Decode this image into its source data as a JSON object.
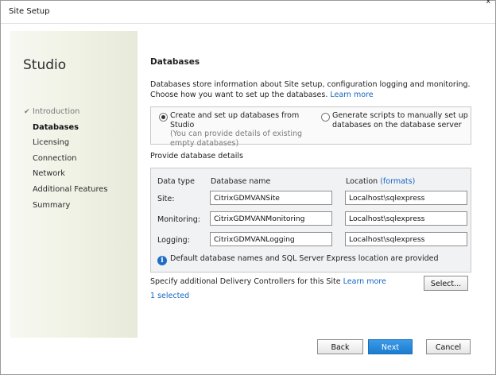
{
  "window": {
    "title": "Site Setup",
    "corner_mark": "x"
  },
  "sidebar": {
    "brand": "Studio",
    "steps": [
      {
        "label": "Introduction",
        "state": "done"
      },
      {
        "label": "Databases",
        "state": "active"
      },
      {
        "label": "Licensing",
        "state": "pending"
      },
      {
        "label": "Connection",
        "state": "pending"
      },
      {
        "label": "Network",
        "state": "pending"
      },
      {
        "label": "Additional Features",
        "state": "pending"
      },
      {
        "label": "Summary",
        "state": "pending"
      }
    ]
  },
  "main": {
    "heading": "Databases",
    "intro_line1": "Databases store information about Site setup, configuration logging and monitoring.",
    "intro_line2": "Choose how you want to set up the databases.",
    "learn_more": "Learn more",
    "options": {
      "create": {
        "label": "Create and set up databases from Studio",
        "sub": "(You can provide details of existing empty databases)",
        "selected": true
      },
      "generate": {
        "label": "Generate scripts to manually set up databases on the database server",
        "selected": false
      }
    },
    "details_label": "Provide database details",
    "table": {
      "col_type": "Data type",
      "col_name": "Database name",
      "col_location": "Location",
      "formats_link": "(formats)",
      "rows": [
        {
          "type": "Site:",
          "name": "CitrixGDMVANSite",
          "location": "Localhost\\sqlexpress"
        },
        {
          "type": "Monitoring:",
          "name": "CitrixGDMVANMonitoring",
          "location": "Localhost\\sqlexpress"
        },
        {
          "type": "Logging:",
          "name": "CitrixGDMVANLogging",
          "location": "Localhost\\sqlexpress"
        }
      ],
      "info_text": "Default database names and SQL Server Express location are provided"
    },
    "controllers": {
      "label": "Specify additional Delivery Controllers for this Site",
      "learn_more": "Learn more",
      "select_button": "Select...",
      "selected_count": "1 selected"
    },
    "buttons": {
      "back": "Back",
      "next": "Next",
      "cancel": "Cancel"
    }
  },
  "colors": {
    "link": "#1565c0",
    "primary_button": "#1c7dd0",
    "info_icon": "#1f6ec4"
  }
}
